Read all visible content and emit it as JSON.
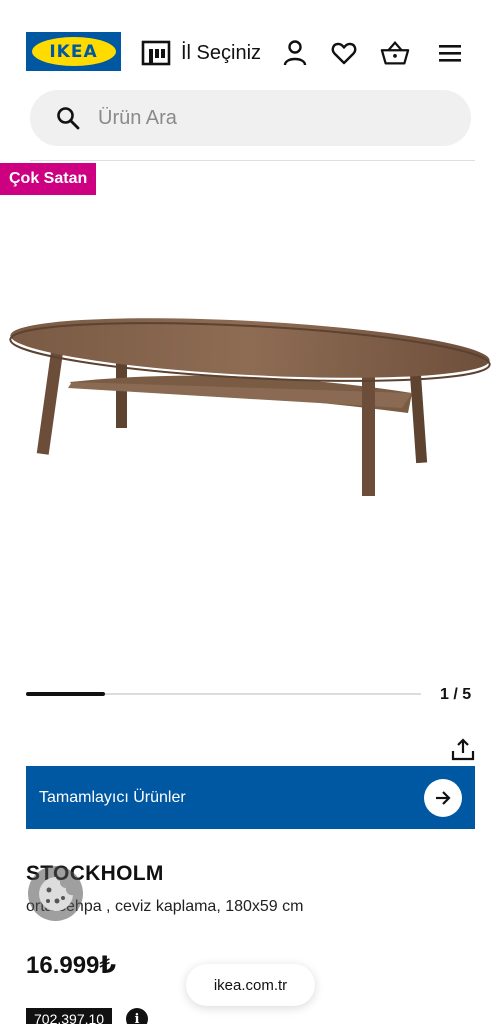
{
  "header": {
    "logo_text": "IKEA",
    "store_label": "İl Seçiniz",
    "icons": [
      "store-icon",
      "user-icon",
      "heart-icon",
      "basket-icon",
      "menu-icon"
    ]
  },
  "search": {
    "placeholder": "Ürün Ara"
  },
  "product": {
    "badge": "Çok Satan",
    "gallery_current": 1,
    "gallery_total": 5,
    "gallery_pager": "1 / 5",
    "complementary_label": "Tamamlayıcı Ürünler",
    "name": "STOCKHOLM",
    "description": "orta sehpa , ceviz kaplama, 180x59 cm",
    "price": "16.999₺",
    "article_number": "702.397.10",
    "info_glyph": "i"
  },
  "browser": {
    "url": "ikea.com.tr"
  },
  "colors": {
    "brand_blue": "#0058a3",
    "brand_yellow": "#ffdb00",
    "badge_magenta": "#cc0081"
  }
}
